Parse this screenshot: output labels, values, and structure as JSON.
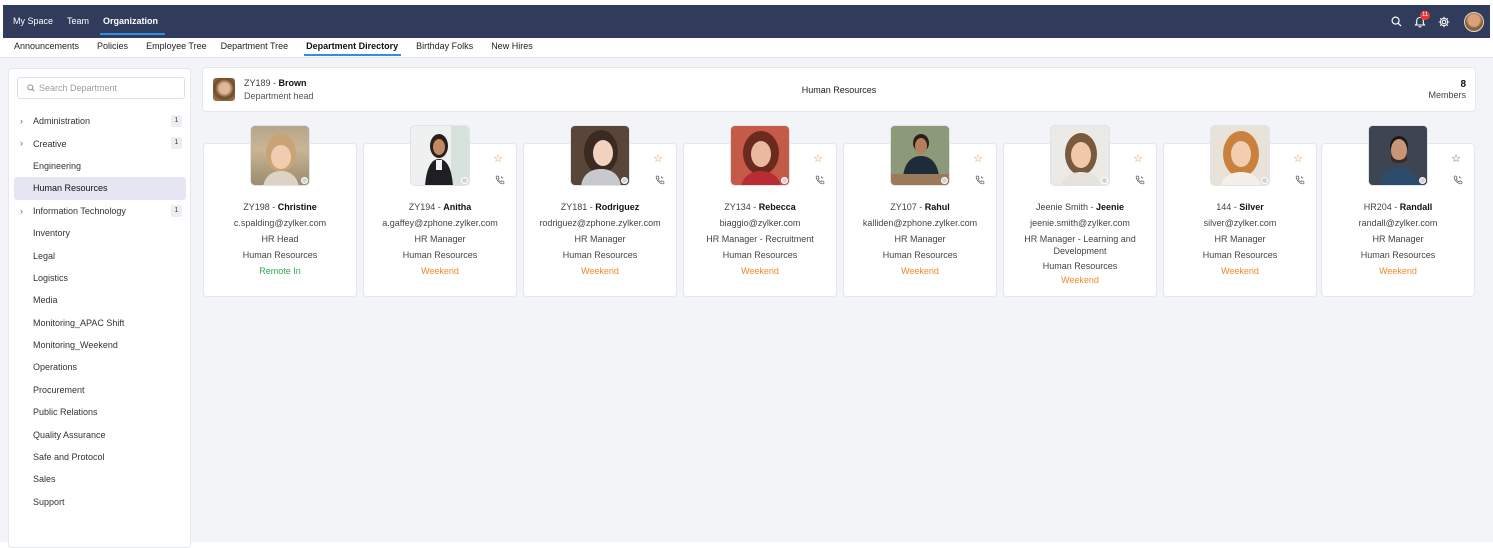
{
  "topnav": {
    "tabs": [
      {
        "label": "My Space"
      },
      {
        "label": "Team"
      },
      {
        "label": "Organization"
      }
    ],
    "notifications_count": "11"
  },
  "subnav": {
    "tabs": [
      {
        "label": "Announcements"
      },
      {
        "label": "Policies"
      },
      {
        "label": "Employee Tree"
      },
      {
        "label": "Department Tree"
      },
      {
        "label": "Department Directory"
      },
      {
        "label": "Birthday Folks"
      },
      {
        "label": "New Hires"
      }
    ]
  },
  "sidebar": {
    "search_placeholder": "Search Department",
    "items": [
      {
        "label": "Administration",
        "count": "1"
      },
      {
        "label": "Creative",
        "count": "1"
      },
      {
        "label": "Engineering"
      },
      {
        "label": "Human Resources"
      },
      {
        "label": "Information Technology",
        "count": "1"
      },
      {
        "label": "Inventory"
      },
      {
        "label": "Legal"
      },
      {
        "label": "Logistics"
      },
      {
        "label": "Media"
      },
      {
        "label": "Monitoring_APAC Shift"
      },
      {
        "label": "Monitoring_Weekend"
      },
      {
        "label": "Operations"
      },
      {
        "label": "Procurement"
      },
      {
        "label": "Public Relations"
      },
      {
        "label": "Quality Assurance"
      },
      {
        "label": "Safe and Protocol"
      },
      {
        "label": "Sales"
      },
      {
        "label": "Support"
      }
    ]
  },
  "header": {
    "head_id": "ZY189",
    "head_name": "Brown",
    "head_role": "Department head",
    "department_name": "Human Resources",
    "member_count": "8",
    "member_label": "Members"
  },
  "employees": [
    {
      "id": "ZY198",
      "name": "Christine",
      "email": "c.spalding@zylker.com",
      "role": "HR Head",
      "department": "Human Resources",
      "status": "Remote In"
    },
    {
      "id": "ZY194",
      "name": "Anitha",
      "email": "a.gaffey@zphone.zylker.com",
      "role": "HR Manager",
      "department": "Human Resources",
      "status": "Weekend"
    },
    {
      "id": "ZY181",
      "name": "Rodriguez",
      "email": "rodriguez@zphone.zylker.com",
      "role": "HR Manager",
      "department": "Human Resources",
      "status": "Weekend"
    },
    {
      "id": "ZY134",
      "name": "Rebecca",
      "email": "biaggio@zylker.com",
      "role": "HR Manager - Recruitment",
      "department": "Human Resources",
      "status": "Weekend"
    },
    {
      "id": "ZY107",
      "name": "Rahul",
      "email": "kalliden@zphone.zylker.com",
      "role": "HR Manager",
      "department": "Human Resources",
      "status": "Weekend"
    },
    {
      "id": "Jeenie Smith",
      "name": "Jeenie",
      "email": "jeenie.smith@zylker.com",
      "role": "HR Manager - Learning and Development",
      "department": "Human Resources",
      "status": "Weekend"
    },
    {
      "id": "144",
      "name": "Silver",
      "email": "silver@zylker.com",
      "role": "HR Manager",
      "department": "Human Resources",
      "status": "Weekend"
    },
    {
      "id": "HR204",
      "name": "Randall",
      "email": "randall@zylker.com",
      "role": "HR Manager",
      "department": "Human Resources",
      "status": "Weekend"
    }
  ],
  "colors": {
    "topnav_bg": "#313b5c",
    "accent": "#2f8fe8",
    "status_weekend": "#f08a2b",
    "status_remote": "#2faa55",
    "active_dept_bg": "#e5e6f2"
  }
}
